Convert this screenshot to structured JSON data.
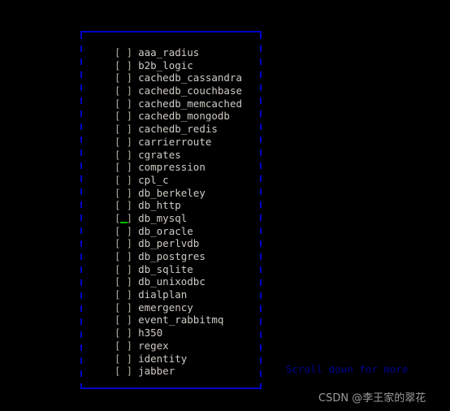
{
  "terminal": {
    "background": "#000000",
    "frame_color": "#0000c8",
    "text_color": "#cfcbc4",
    "bracket_color": "#b0a89c",
    "cursor_color": "#00c000"
  },
  "dialog": {
    "name": "module-selection-checklist",
    "unchecked_mark": " ",
    "bracket_open": "[",
    "bracket_close": "]",
    "items": [
      {
        "label": "aaa_radius",
        "checked": false,
        "selected": false
      },
      {
        "label": "b2b_logic",
        "checked": false,
        "selected": false
      },
      {
        "label": "cachedb_cassandra",
        "checked": false,
        "selected": false
      },
      {
        "label": "cachedb_couchbase",
        "checked": false,
        "selected": false
      },
      {
        "label": "cachedb_memcached",
        "checked": false,
        "selected": false
      },
      {
        "label": "cachedb_mongodb",
        "checked": false,
        "selected": false
      },
      {
        "label": "cachedb_redis",
        "checked": false,
        "selected": false
      },
      {
        "label": "carrierroute",
        "checked": false,
        "selected": false
      },
      {
        "label": "cgrates",
        "checked": false,
        "selected": false
      },
      {
        "label": "compression",
        "checked": false,
        "selected": false
      },
      {
        "label": "cpl_c",
        "checked": false,
        "selected": false
      },
      {
        "label": "db_berkeley",
        "checked": false,
        "selected": false
      },
      {
        "label": "db_http",
        "checked": false,
        "selected": false
      },
      {
        "label": "db_mysql",
        "checked": false,
        "selected": true
      },
      {
        "label": "db_oracle",
        "checked": false,
        "selected": false
      },
      {
        "label": "db_perlvdb",
        "checked": false,
        "selected": false
      },
      {
        "label": "db_postgres",
        "checked": false,
        "selected": false
      },
      {
        "label": "db_sqlite",
        "checked": false,
        "selected": false
      },
      {
        "label": "db_unixodbc",
        "checked": false,
        "selected": false
      },
      {
        "label": "dialplan",
        "checked": false,
        "selected": false
      },
      {
        "label": "emergency",
        "checked": false,
        "selected": false
      },
      {
        "label": "event_rabbitmq",
        "checked": false,
        "selected": false
      },
      {
        "label": "h350",
        "checked": false,
        "selected": false
      },
      {
        "label": "regex",
        "checked": false,
        "selected": false
      },
      {
        "label": "identity",
        "checked": false,
        "selected": false
      },
      {
        "label": "jabber",
        "checked": false,
        "selected": false
      }
    ]
  },
  "hints": {
    "scroll_more": "Scroll down for more"
  },
  "watermark": {
    "text": "CSDN @李王家的翠花"
  }
}
